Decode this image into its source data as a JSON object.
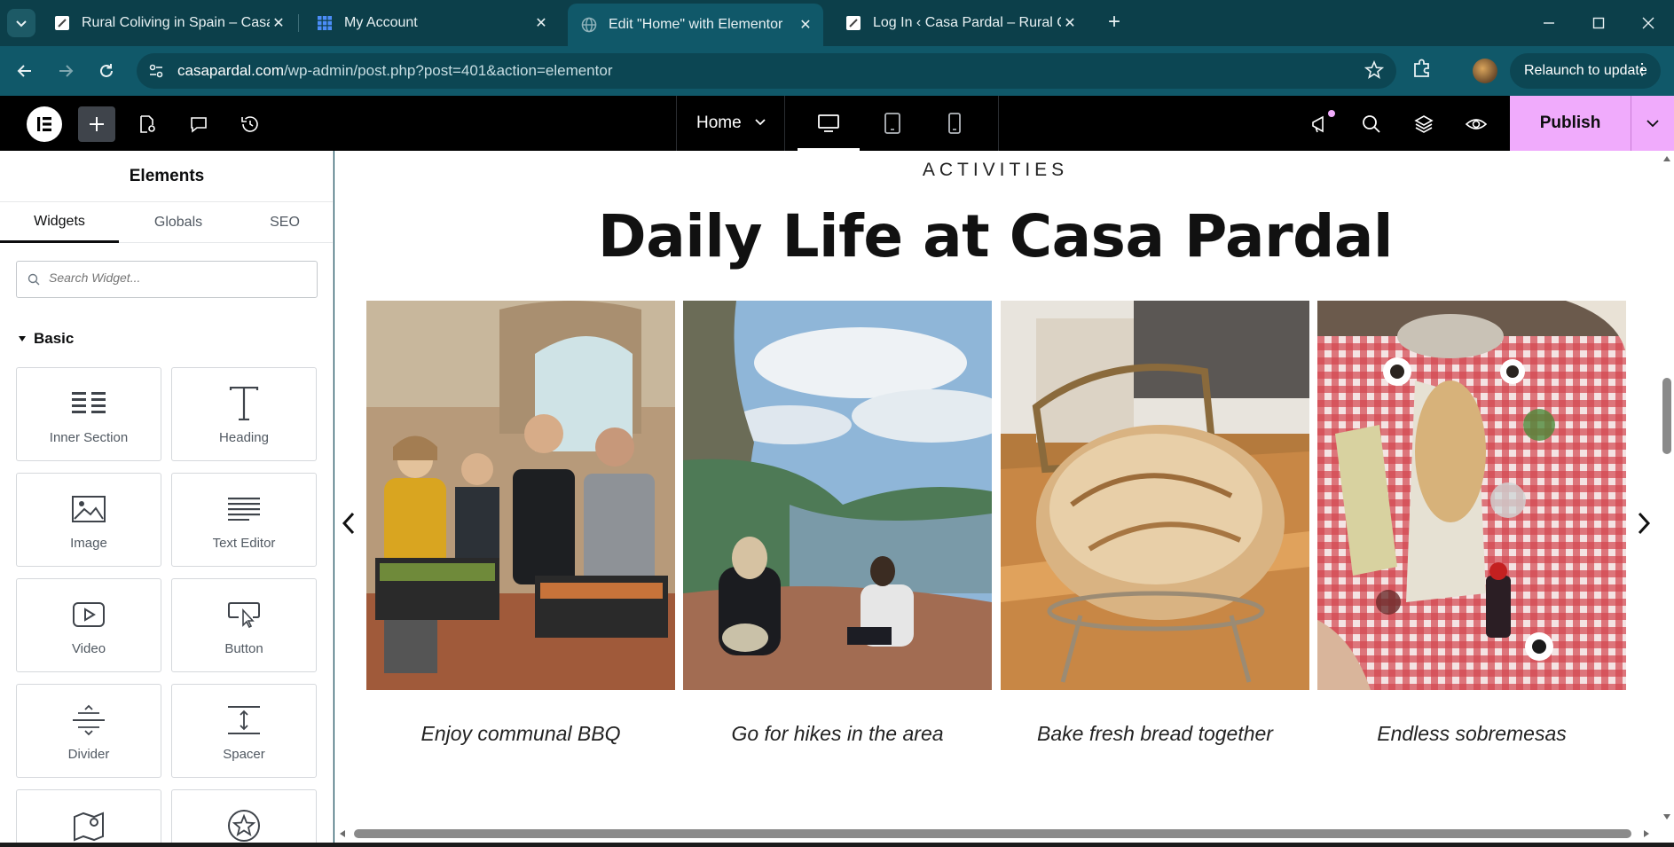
{
  "browser": {
    "tabs": [
      {
        "title": "Rural Coliving in Spain – Casa Pardal",
        "active": false
      },
      {
        "title": "My Account",
        "active": false
      },
      {
        "title": "Edit \"Home\" with Elementor",
        "active": true
      },
      {
        "title": "Log In ‹ Casa Pardal – Rural Coliving",
        "active": false
      }
    ],
    "url_host": "casapardal.com",
    "url_path": "/wp-admin/post.php?post=401&action=elementor",
    "relaunch_label": "Relaunch to update"
  },
  "editor": {
    "page_name": "Home",
    "publish_label": "Publish"
  },
  "sidebar": {
    "title": "Elements",
    "tabs": [
      "Widgets",
      "Globals",
      "SEO"
    ],
    "search_placeholder": "Search Widget...",
    "category": "Basic",
    "widgets": [
      {
        "label": "Inner Section",
        "icon": "inner-section-icon"
      },
      {
        "label": "Heading",
        "icon": "heading-icon"
      },
      {
        "label": "Image",
        "icon": "image-icon"
      },
      {
        "label": "Text Editor",
        "icon": "text-editor-icon"
      },
      {
        "label": "Video",
        "icon": "video-icon"
      },
      {
        "label": "Button",
        "icon": "button-icon"
      },
      {
        "label": "Divider",
        "icon": "divider-icon"
      },
      {
        "label": "Spacer",
        "icon": "spacer-icon"
      },
      {
        "label": "",
        "icon": "google-maps-icon"
      },
      {
        "label": "",
        "icon": "star-icon"
      }
    ]
  },
  "canvas": {
    "eyebrow": "ACTIVITIES",
    "headline": "Daily Life at Casa Pardal",
    "slides": [
      {
        "caption": "Enjoy communal BBQ",
        "image": "bbq-photo"
      },
      {
        "caption": "Go for hikes in the area",
        "image": "hike-photo"
      },
      {
        "caption": "Bake fresh bread together",
        "image": "bread-photo"
      },
      {
        "caption": "Endless sobremesas",
        "image": "table-photo"
      }
    ]
  },
  "colors": {
    "chrome_dark": "#0c3f4a",
    "chrome_active": "#105869",
    "editor_bar": "#000000",
    "publish": "#f0abfc"
  }
}
